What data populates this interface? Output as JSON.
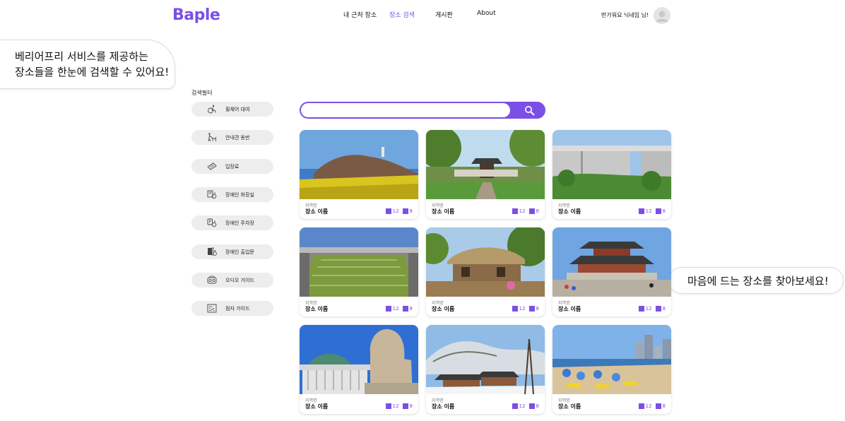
{
  "header": {
    "logo": "Baple",
    "nav": [
      "내 근처 장소",
      "장소 검색",
      "게시판",
      "About"
    ],
    "active_nav": "장소 검색",
    "greeting": "반가워요 닉네임 님!"
  },
  "callouts": {
    "left_line1": "베리어프리 서비스를 제공하는",
    "left_line2": "장소들을 한눈에 검색할 수 있어요!",
    "right": "마음에 드는 장소를 찾아보세요!"
  },
  "filters": {
    "title": "검색필터",
    "items": [
      {
        "label": "휠체어 대여",
        "icon": "wheelchair-icon"
      },
      {
        "label": "안내견 동반",
        "icon": "guide-dog-icon"
      },
      {
        "label": "입장료",
        "icon": "ticket-icon"
      },
      {
        "label": "장애인 화장실",
        "icon": "accessible-toilet-icon"
      },
      {
        "label": "장애인 주차장",
        "icon": "accessible-parking-icon"
      },
      {
        "label": "장애인 출입문",
        "icon": "accessible-door-icon"
      },
      {
        "label": "오디오 가이드",
        "icon": "audio-guide-icon"
      },
      {
        "label": "점자 가이드",
        "icon": "braille-guide-icon"
      }
    ]
  },
  "search": {
    "value": "",
    "placeholder": "",
    "button_icon": "search-icon"
  },
  "colors": {
    "accent": "#7b4fe6"
  },
  "places": [
    {
      "region": "지역명",
      "name": "장소 이름",
      "count_a": "12",
      "count_b": "8",
      "scene": "coastal-hill"
    },
    {
      "region": "지역명",
      "name": "장소 이름",
      "count_a": "12",
      "count_b": "8",
      "scene": "traditional-gate"
    },
    {
      "region": "지역명",
      "name": "장소 이름",
      "count_a": "12",
      "count_b": "8",
      "scene": "modern-museum"
    },
    {
      "region": "지역명",
      "name": "장소 이름",
      "count_a": "12",
      "count_b": "8",
      "scene": "memorial-park"
    },
    {
      "region": "지역명",
      "name": "장소 이름",
      "count_a": "12",
      "count_b": "8",
      "scene": "thatched-house"
    },
    {
      "region": "지역명",
      "name": "장소 이름",
      "count_a": "12",
      "count_b": "8",
      "scene": "palace"
    },
    {
      "region": "지역명",
      "name": "장소 이름",
      "count_a": "12",
      "count_b": "8",
      "scene": "assembly-haetae"
    },
    {
      "region": "지역명",
      "name": "장소 이름",
      "count_a": "12",
      "count_b": "8",
      "scene": "snowy-temple"
    },
    {
      "region": "지역명",
      "name": "장소 이름",
      "count_a": "12",
      "count_b": "8",
      "scene": "beach"
    }
  ]
}
